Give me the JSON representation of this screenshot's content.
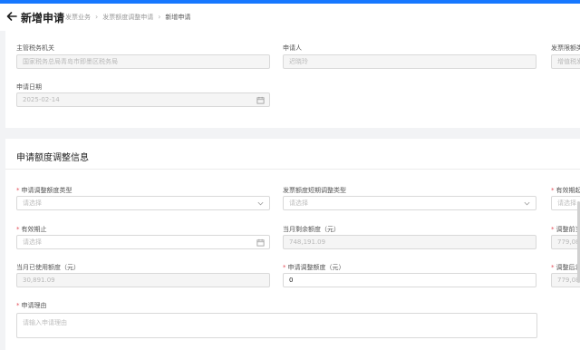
{
  "header": {
    "title": "新增申请",
    "breadcrumbs": [
      "发票业务",
      "发票额度调整申请",
      "新增申请"
    ]
  },
  "basic": {
    "tax_office": {
      "label": "主管税务机关",
      "value": "国家税务总局青岛市即墨区税务局"
    },
    "applicant": {
      "label": "申请人",
      "value": "迟晓玲"
    },
    "invoice_type": {
      "label": "发票限额类",
      "value": "增值税发"
    },
    "apply_date": {
      "label": "申请日期",
      "value": "2025-02-14"
    }
  },
  "adjust": {
    "section_title": "申请额度调整信息",
    "adjust_type": {
      "label": "申请调整额度类型",
      "placeholder": "请选择"
    },
    "short_term_type": {
      "label": "发票额度短期调整类型",
      "placeholder": "请选择"
    },
    "valid_from": {
      "label": "有效期起",
      "placeholder": "请选择"
    },
    "valid_to": {
      "label": "有效期止",
      "placeholder": "请选择"
    },
    "month_remaining": {
      "label": "当月剩余额度（元）",
      "value": "748,191.09"
    },
    "before_adjust": {
      "label": "调整前当",
      "value": "779,082."
    },
    "month_used": {
      "label": "当月已使用额度（元）",
      "value": "30,891.09"
    },
    "apply_amount": {
      "label": "申请调整额度（元）",
      "value": "0"
    },
    "after_adjust": {
      "label": "调整后发",
      "value": "779,082."
    },
    "reason": {
      "label": "申请理由",
      "placeholder": "请输入申请理由"
    }
  },
  "colors": {
    "accent": "#1677ff",
    "required": "#e34d59"
  }
}
